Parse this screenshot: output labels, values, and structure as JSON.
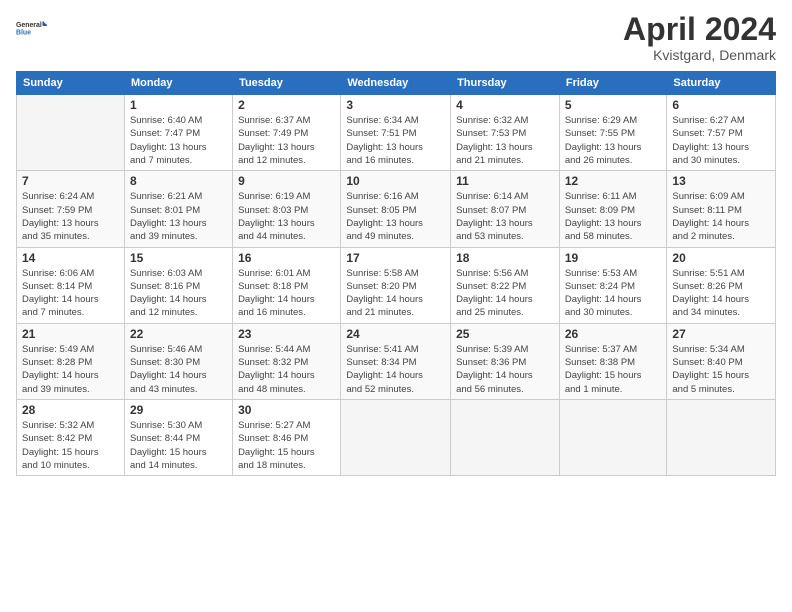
{
  "logo": {
    "general": "General",
    "blue": "Blue"
  },
  "title": "April 2024",
  "subtitle": "Kvistgard, Denmark",
  "headers": [
    "Sunday",
    "Monday",
    "Tuesday",
    "Wednesday",
    "Thursday",
    "Friday",
    "Saturday"
  ],
  "weeks": [
    [
      {
        "day": "",
        "info": ""
      },
      {
        "day": "1",
        "info": "Sunrise: 6:40 AM\nSunset: 7:47 PM\nDaylight: 13 hours\nand 7 minutes."
      },
      {
        "day": "2",
        "info": "Sunrise: 6:37 AM\nSunset: 7:49 PM\nDaylight: 13 hours\nand 12 minutes."
      },
      {
        "day": "3",
        "info": "Sunrise: 6:34 AM\nSunset: 7:51 PM\nDaylight: 13 hours\nand 16 minutes."
      },
      {
        "day": "4",
        "info": "Sunrise: 6:32 AM\nSunset: 7:53 PM\nDaylight: 13 hours\nand 21 minutes."
      },
      {
        "day": "5",
        "info": "Sunrise: 6:29 AM\nSunset: 7:55 PM\nDaylight: 13 hours\nand 26 minutes."
      },
      {
        "day": "6",
        "info": "Sunrise: 6:27 AM\nSunset: 7:57 PM\nDaylight: 13 hours\nand 30 minutes."
      }
    ],
    [
      {
        "day": "7",
        "info": "Sunrise: 6:24 AM\nSunset: 7:59 PM\nDaylight: 13 hours\nand 35 minutes."
      },
      {
        "day": "8",
        "info": "Sunrise: 6:21 AM\nSunset: 8:01 PM\nDaylight: 13 hours\nand 39 minutes."
      },
      {
        "day": "9",
        "info": "Sunrise: 6:19 AM\nSunset: 8:03 PM\nDaylight: 13 hours\nand 44 minutes."
      },
      {
        "day": "10",
        "info": "Sunrise: 6:16 AM\nSunset: 8:05 PM\nDaylight: 13 hours\nand 49 minutes."
      },
      {
        "day": "11",
        "info": "Sunrise: 6:14 AM\nSunset: 8:07 PM\nDaylight: 13 hours\nand 53 minutes."
      },
      {
        "day": "12",
        "info": "Sunrise: 6:11 AM\nSunset: 8:09 PM\nDaylight: 13 hours\nand 58 minutes."
      },
      {
        "day": "13",
        "info": "Sunrise: 6:09 AM\nSunset: 8:11 PM\nDaylight: 14 hours\nand 2 minutes."
      }
    ],
    [
      {
        "day": "14",
        "info": "Sunrise: 6:06 AM\nSunset: 8:14 PM\nDaylight: 14 hours\nand 7 minutes."
      },
      {
        "day": "15",
        "info": "Sunrise: 6:03 AM\nSunset: 8:16 PM\nDaylight: 14 hours\nand 12 minutes."
      },
      {
        "day": "16",
        "info": "Sunrise: 6:01 AM\nSunset: 8:18 PM\nDaylight: 14 hours\nand 16 minutes."
      },
      {
        "day": "17",
        "info": "Sunrise: 5:58 AM\nSunset: 8:20 PM\nDaylight: 14 hours\nand 21 minutes."
      },
      {
        "day": "18",
        "info": "Sunrise: 5:56 AM\nSunset: 8:22 PM\nDaylight: 14 hours\nand 25 minutes."
      },
      {
        "day": "19",
        "info": "Sunrise: 5:53 AM\nSunset: 8:24 PM\nDaylight: 14 hours\nand 30 minutes."
      },
      {
        "day": "20",
        "info": "Sunrise: 5:51 AM\nSunset: 8:26 PM\nDaylight: 14 hours\nand 34 minutes."
      }
    ],
    [
      {
        "day": "21",
        "info": "Sunrise: 5:49 AM\nSunset: 8:28 PM\nDaylight: 14 hours\nand 39 minutes."
      },
      {
        "day": "22",
        "info": "Sunrise: 5:46 AM\nSunset: 8:30 PM\nDaylight: 14 hours\nand 43 minutes."
      },
      {
        "day": "23",
        "info": "Sunrise: 5:44 AM\nSunset: 8:32 PM\nDaylight: 14 hours\nand 48 minutes."
      },
      {
        "day": "24",
        "info": "Sunrise: 5:41 AM\nSunset: 8:34 PM\nDaylight: 14 hours\nand 52 minutes."
      },
      {
        "day": "25",
        "info": "Sunrise: 5:39 AM\nSunset: 8:36 PM\nDaylight: 14 hours\nand 56 minutes."
      },
      {
        "day": "26",
        "info": "Sunrise: 5:37 AM\nSunset: 8:38 PM\nDaylight: 15 hours\nand 1 minute."
      },
      {
        "day": "27",
        "info": "Sunrise: 5:34 AM\nSunset: 8:40 PM\nDaylight: 15 hours\nand 5 minutes."
      }
    ],
    [
      {
        "day": "28",
        "info": "Sunrise: 5:32 AM\nSunset: 8:42 PM\nDaylight: 15 hours\nand 10 minutes."
      },
      {
        "day": "29",
        "info": "Sunrise: 5:30 AM\nSunset: 8:44 PM\nDaylight: 15 hours\nand 14 minutes."
      },
      {
        "day": "30",
        "info": "Sunrise: 5:27 AM\nSunset: 8:46 PM\nDaylight: 15 hours\nand 18 minutes."
      },
      {
        "day": "",
        "info": ""
      },
      {
        "day": "",
        "info": ""
      },
      {
        "day": "",
        "info": ""
      },
      {
        "day": "",
        "info": ""
      }
    ]
  ]
}
